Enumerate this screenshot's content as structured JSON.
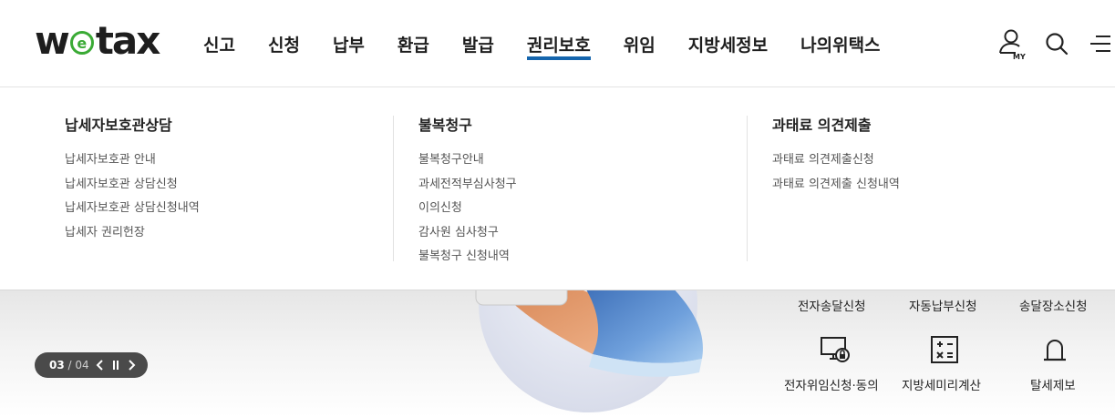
{
  "logo": {
    "text_pre": "w",
    "text_e": "e",
    "text_post": "tax"
  },
  "gnb": [
    {
      "label": "신고"
    },
    {
      "label": "신청"
    },
    {
      "label": "납부"
    },
    {
      "label": "환급"
    },
    {
      "label": "발급"
    },
    {
      "label": "권리보호"
    },
    {
      "label": "위임"
    },
    {
      "label": "지방세정보"
    },
    {
      "label": "나의위택스"
    }
  ],
  "active_menu": "권리보호",
  "util": {
    "my_label": "MY",
    "icons": [
      "my-user-icon",
      "search-icon",
      "hamburger-menu-icon"
    ]
  },
  "mega": {
    "col1": {
      "title": "납세자보호관상담",
      "links": [
        "납세자보호관 안내",
        "납세자보호관 상담신청",
        "납세자보호관 상담신청내역",
        "납세자 권리헌장"
      ]
    },
    "col2": {
      "title": "불복청구",
      "links": [
        "불복청구안내",
        "과세전적부심사청구",
        "이의신청",
        "감사원 심사청구",
        "불복청구 신청내역"
      ]
    },
    "col3": {
      "title": "과태료 의견제출",
      "links": [
        "과태료 의견제출신청",
        "과태료 의견제출 신청내역"
      ]
    }
  },
  "slider": {
    "current": "03",
    "separator": "/",
    "total": "04"
  },
  "quick_top": [
    "전자송달신청",
    "자동납부신청",
    "송달장소신청"
  ],
  "quick_bottom": [
    {
      "label": "전자위임신청·동의",
      "icon": "monitor-lock-icon"
    },
    {
      "label": "지방세미리계산",
      "icon": "calculator-icon"
    },
    {
      "label": "탈세제보",
      "icon": "siren-icon"
    }
  ],
  "colors": {
    "accent": "#1565ad",
    "logo_green": "#3aaa35",
    "slider_bg": "#4a4a4a"
  }
}
